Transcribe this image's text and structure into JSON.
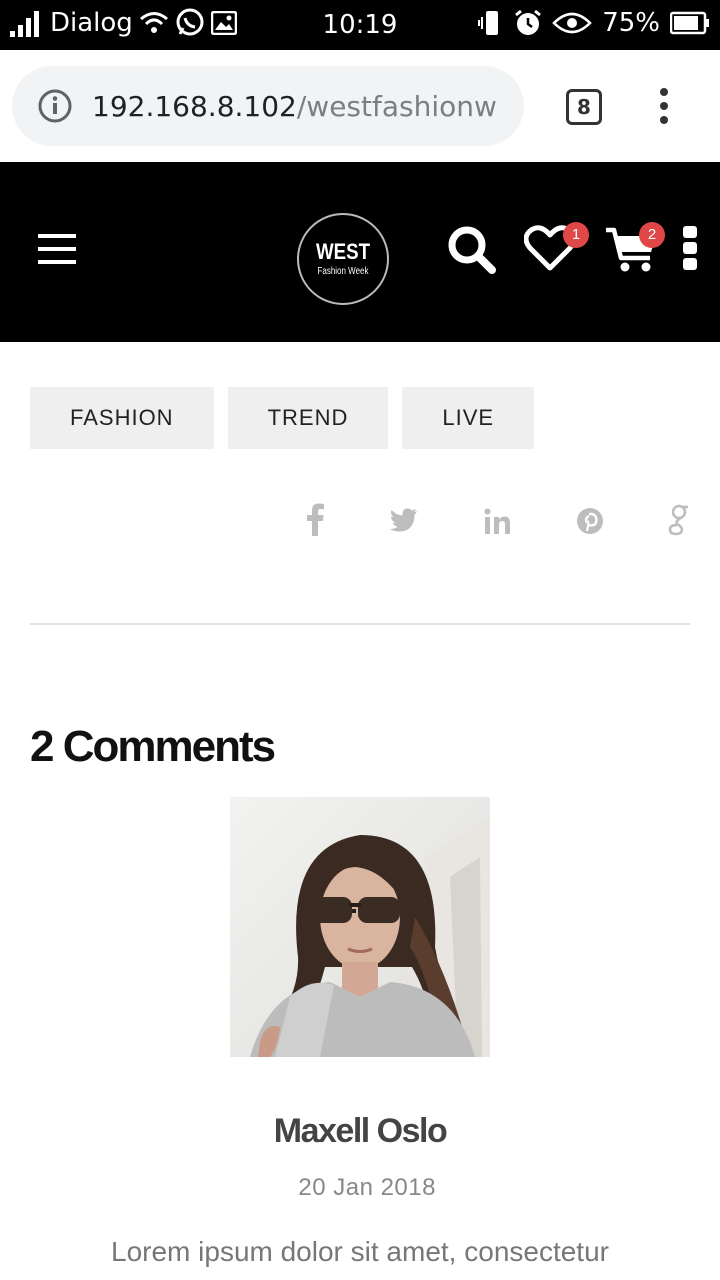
{
  "status_bar": {
    "carrier": "Dialog",
    "time": "10:19",
    "battery": "75%"
  },
  "browser": {
    "url_host": "192.168.8.102",
    "url_path": "/westfashionw",
    "tab_count": "8"
  },
  "header": {
    "logo_main": "WEST",
    "logo_sub": "Fashion Week",
    "wishlist_count": "1",
    "cart_count": "2"
  },
  "tags": [
    "FASHION",
    "TREND",
    "LIVE"
  ],
  "share_icons": [
    "facebook-icon",
    "twitter-icon",
    "linkedin-icon",
    "pinterest-icon",
    "google-plus-icon"
  ],
  "comments": {
    "title": "2 Comments",
    "author": "Maxell Oslo",
    "date_icon": "",
    "date": "20 Jan 2018",
    "text": "Lorem ipsum dolor sit amet, consectetur"
  }
}
